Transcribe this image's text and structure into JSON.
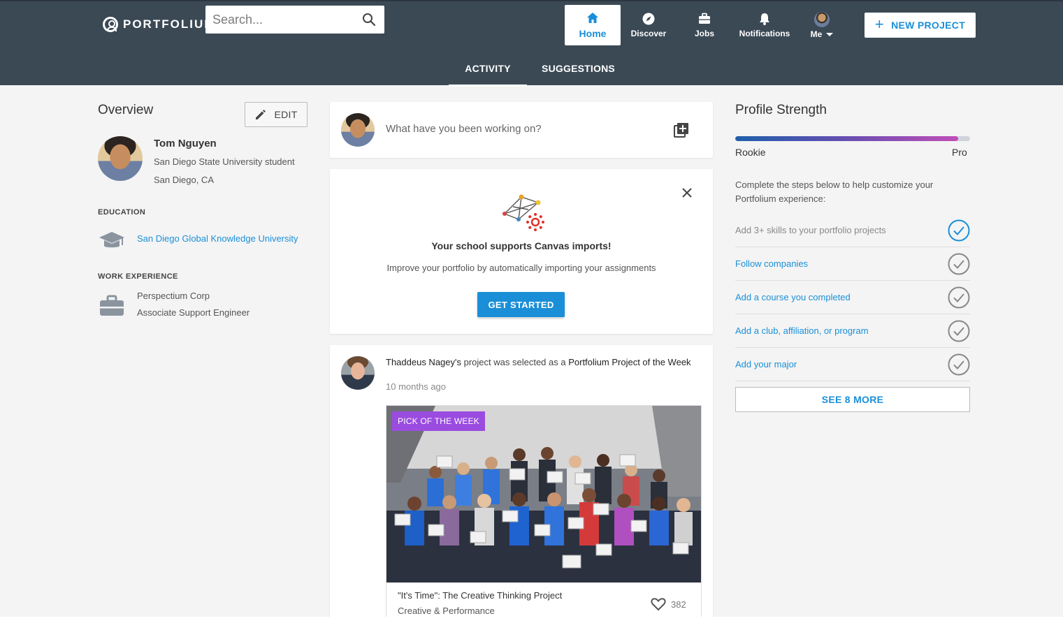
{
  "header": {
    "logo_text": "PORTFOLIUM",
    "search_placeholder": "Search...",
    "nav": [
      {
        "label": "Home",
        "icon": "home-icon",
        "active": true
      },
      {
        "label": "Discover",
        "icon": "compass-icon"
      },
      {
        "label": "Jobs",
        "icon": "briefcase-icon"
      },
      {
        "label": "Notifications",
        "icon": "bell-icon"
      },
      {
        "label": "Me",
        "icon": "avatar"
      }
    ],
    "new_project_label": "NEW PROJECT",
    "tabs": [
      {
        "label": "ACTIVITY",
        "active": true
      },
      {
        "label": "SUGGESTIONS"
      }
    ]
  },
  "overview": {
    "title": "Overview",
    "edit_label": "EDIT",
    "name": "Tom Nguyen",
    "school": "San Diego State University student",
    "location": "San Diego, CA",
    "education_heading": "EDUCATION",
    "education_item": "San Diego Global Knowledge University",
    "work_heading": "WORK EXPERIENCE",
    "work_company": "Perspectium Corp",
    "work_role": "Associate Support Engineer"
  },
  "composer": {
    "placeholder": "What have you been working on?"
  },
  "canvas_card": {
    "headline": "Your school supports Canvas imports!",
    "subtext": "Improve your portfolio by automatically importing your assignments",
    "button_label": "GET STARTED"
  },
  "feed_item": {
    "user": "Thaddeus Nagey's",
    "action": "project was selected as a",
    "highlight": "Portfolium Project of the Week",
    "time": "10 months ago",
    "badge": "PICK OF THE WEEK",
    "project_title": "\"It's Time\": The Creative Thinking Project",
    "project_category": "Creative & Performance",
    "likes": "382"
  },
  "profile_strength": {
    "title": "Profile Strength",
    "progress_fraction": 0.95,
    "left_label": "Rookie",
    "right_label": "Pro",
    "description": "Complete the steps below to help customize your Portfolium experience:",
    "steps": [
      {
        "label": "Add 3+ skills to your portfolio projects",
        "done": true
      },
      {
        "label": "Follow companies",
        "done": false
      },
      {
        "label": "Add a course you completed",
        "done": false
      },
      {
        "label": "Add a club, affiliation, or program",
        "done": false
      },
      {
        "label": "Add your major",
        "done": false
      }
    ],
    "see_more_label": "SEE 8 MORE"
  },
  "colors": {
    "header_bg": "#3b4955",
    "accent": "#1a8fd8",
    "badge": "#9b4ce0"
  }
}
